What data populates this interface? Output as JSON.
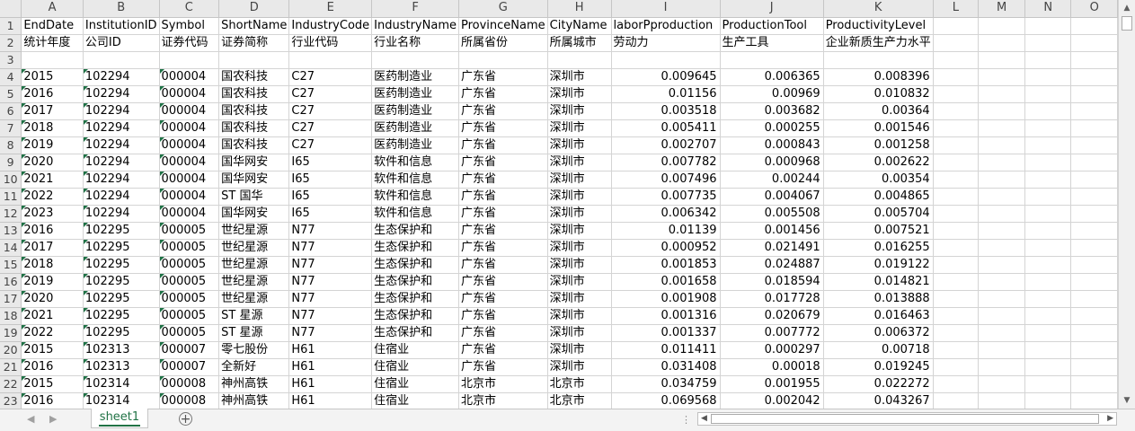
{
  "columns": [
    "A",
    "B",
    "C",
    "D",
    "E",
    "F",
    "G",
    "H",
    "I",
    "J",
    "K",
    "L",
    "M",
    "N",
    "O"
  ],
  "rows": [
    {
      "n": "1",
      "cells": [
        "EndDate",
        "InstitutionID",
        "Symbol",
        "ShortName",
        "IndustryCode",
        "IndustryName",
        "ProvinceName",
        "CityName",
        "laborPproduction",
        "ProductionTool",
        "ProductivityLevel",
        "",
        "",
        "",
        ""
      ]
    },
    {
      "n": "2",
      "cells": [
        "统计年度",
        "公司ID",
        "证券代码",
        "证券简称",
        "行业代码",
        "行业名称",
        "所属省份",
        "所属城市",
        "劳动力",
        "生产工具",
        "企业新质生产力水平",
        "",
        "",
        "",
        ""
      ]
    },
    {
      "n": "3",
      "cells": [
        "",
        "",
        "",
        "",
        "",
        "",
        "",
        "",
        "",
        "",
        "",
        "",
        "",
        "",
        ""
      ]
    },
    {
      "n": "4",
      "cells": [
        "2015",
        "102294",
        "000004",
        "国农科技",
        "C27",
        "医药制造业",
        "广东省",
        "深圳市",
        "0.009645",
        "0.006365",
        "0.008396",
        "",
        "",
        "",
        ""
      ]
    },
    {
      "n": "5",
      "cells": [
        "2016",
        "102294",
        "000004",
        "国农科技",
        "C27",
        "医药制造业",
        "广东省",
        "深圳市",
        "0.01156",
        "0.00969",
        "0.010832",
        "",
        "",
        "",
        ""
      ]
    },
    {
      "n": "6",
      "cells": [
        "2017",
        "102294",
        "000004",
        "国农科技",
        "C27",
        "医药制造业",
        "广东省",
        "深圳市",
        "0.003518",
        "0.003682",
        "0.00364",
        "",
        "",
        "",
        ""
      ]
    },
    {
      "n": "7",
      "cells": [
        "2018",
        "102294",
        "000004",
        "国农科技",
        "C27",
        "医药制造业",
        "广东省",
        "深圳市",
        "0.005411",
        "0.000255",
        "0.001546",
        "",
        "",
        "",
        ""
      ]
    },
    {
      "n": "8",
      "cells": [
        "2019",
        "102294",
        "000004",
        "国农科技",
        "C27",
        "医药制造业",
        "广东省",
        "深圳市",
        "0.002707",
        "0.000843",
        "0.001258",
        "",
        "",
        "",
        ""
      ]
    },
    {
      "n": "9",
      "cells": [
        "2020",
        "102294",
        "000004",
        "国华网安",
        "I65",
        "软件和信息",
        "广东省",
        "深圳市",
        "0.007782",
        "0.000968",
        "0.002622",
        "",
        "",
        "",
        ""
      ]
    },
    {
      "n": "10",
      "cells": [
        "2021",
        "102294",
        "000004",
        "国华网安",
        "I65",
        "软件和信息",
        "广东省",
        "深圳市",
        "0.007496",
        "0.00244",
        "0.00354",
        "",
        "",
        "",
        ""
      ]
    },
    {
      "n": "11",
      "cells": [
        "2022",
        "102294",
        "000004",
        "ST 国华",
        "I65",
        "软件和信息",
        "广东省",
        "深圳市",
        "0.007735",
        "0.004067",
        "0.004865",
        "",
        "",
        "",
        ""
      ]
    },
    {
      "n": "12",
      "cells": [
        "2023",
        "102294",
        "000004",
        "国华网安",
        "I65",
        "软件和信息",
        "广东省",
        "深圳市",
        "0.006342",
        "0.005508",
        "0.005704",
        "",
        "",
        "",
        ""
      ]
    },
    {
      "n": "13",
      "cells": [
        "2016",
        "102295",
        "000005",
        "世纪星源",
        "N77",
        "生态保护和",
        "广东省",
        "深圳市",
        "0.01139",
        "0.001456",
        "0.007521",
        "",
        "",
        "",
        ""
      ]
    },
    {
      "n": "14",
      "cells": [
        "2017",
        "102295",
        "000005",
        "世纪星源",
        "N77",
        "生态保护和",
        "广东省",
        "深圳市",
        "0.000952",
        "0.021491",
        "0.016255",
        "",
        "",
        "",
        ""
      ]
    },
    {
      "n": "15",
      "cells": [
        "2018",
        "102295",
        "000005",
        "世纪星源",
        "N77",
        "生态保护和",
        "广东省",
        "深圳市",
        "0.001853",
        "0.024887",
        "0.019122",
        "",
        "",
        "",
        ""
      ]
    },
    {
      "n": "16",
      "cells": [
        "2019",
        "102295",
        "000005",
        "世纪星源",
        "N77",
        "生态保护和",
        "广东省",
        "深圳市",
        "0.001658",
        "0.018594",
        "0.014821",
        "",
        "",
        "",
        ""
      ]
    },
    {
      "n": "17",
      "cells": [
        "2020",
        "102295",
        "000005",
        "世纪星源",
        "N77",
        "生态保护和",
        "广东省",
        "深圳市",
        "0.001908",
        "0.017728",
        "0.013888",
        "",
        "",
        "",
        ""
      ]
    },
    {
      "n": "18",
      "cells": [
        "2021",
        "102295",
        "000005",
        "ST 星源",
        "N77",
        "生态保护和",
        "广东省",
        "深圳市",
        "0.001316",
        "0.020679",
        "0.016463",
        "",
        "",
        "",
        ""
      ]
    },
    {
      "n": "19",
      "cells": [
        "2022",
        "102295",
        "000005",
        "ST 星源",
        "N77",
        "生态保护和",
        "广东省",
        "深圳市",
        "0.001337",
        "0.007772",
        "0.006372",
        "",
        "",
        "",
        ""
      ]
    },
    {
      "n": "20",
      "cells": [
        "2015",
        "102313",
        "000007",
        "零七股份",
        "H61",
        "住宿业",
        "广东省",
        "深圳市",
        "0.011411",
        "0.000297",
        "0.00718",
        "",
        "",
        "",
        ""
      ]
    },
    {
      "n": "21",
      "cells": [
        "2016",
        "102313",
        "000007",
        "全新好",
        "H61",
        "住宿业",
        "广东省",
        "深圳市",
        "0.031408",
        "0.00018",
        "0.019245",
        "",
        "",
        "",
        ""
      ]
    },
    {
      "n": "22",
      "cells": [
        "2015",
        "102314",
        "000008",
        "神州高铁",
        "H61",
        "住宿业",
        "北京市",
        "北京市",
        "0.034759",
        "0.001955",
        "0.022272",
        "",
        "",
        "",
        ""
      ]
    },
    {
      "n": "23",
      "cells": [
        "2016",
        "102314",
        "000008",
        "神州高铁",
        "H61",
        "住宿业",
        "北京市",
        "北京市",
        "0.069568",
        "0.002042",
        "0.043267",
        "",
        "",
        "",
        ""
      ]
    }
  ],
  "sheet_tab": "sheet1",
  "add_sheet_icon": "plus-circle-icon",
  "accent_color": "#217346"
}
